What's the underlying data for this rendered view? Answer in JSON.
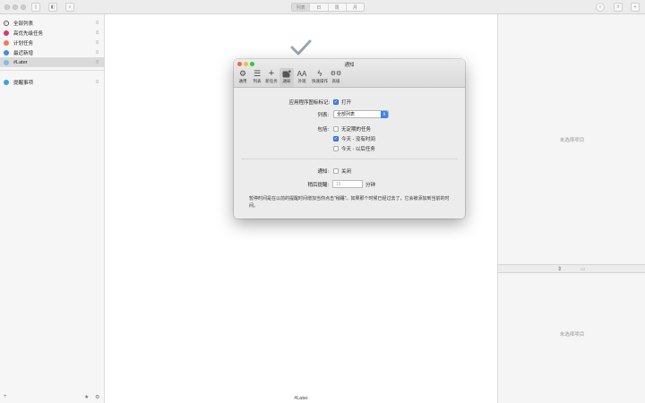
{
  "toolbar": {
    "view_segments": [
      "列表",
      "日",
      "周",
      "月"
    ],
    "active_segment": 0
  },
  "sidebar": {
    "items": [
      {
        "label": "全部列表",
        "count": "0",
        "color": "#ffffff",
        "icon": "check-circle-icon"
      },
      {
        "label": "高优先级任务",
        "count": "0",
        "color": "#e0336e"
      },
      {
        "label": "计划任务",
        "count": "0",
        "color": "#f07b5a"
      },
      {
        "label": "最近新增",
        "count": "0",
        "color": "#3f8fd8"
      },
      {
        "label": "#Later",
        "count": "0",
        "color": "#7bbde8",
        "selected": true
      },
      {
        "label": "提醒事项",
        "count": "0",
        "color": "#3aa3dc"
      }
    ]
  },
  "main": {
    "footer_title": "#Later"
  },
  "right": {
    "top_empty": "未选择项目",
    "bottom_empty": "未选择项目"
  },
  "prefs": {
    "title": "通知",
    "tabs": [
      {
        "label": "通用",
        "icon": "gear-icon"
      },
      {
        "label": "列表",
        "icon": "list-icon"
      },
      {
        "label": "新任务",
        "icon": "plus-icon"
      },
      {
        "label": "通知",
        "icon": "notification-icon",
        "active": true
      },
      {
        "label": "外观",
        "icon": "font-size-icon"
      },
      {
        "label": "快速操作",
        "icon": "lightning-icon"
      },
      {
        "label": "高级",
        "icon": "gears-icon"
      }
    ],
    "badge_label": "应用程序图标标记:",
    "badge_open": "打开",
    "list_label": "列表:",
    "list_value": "全部列表",
    "include_label": "包括:",
    "include_options": [
      {
        "label": "无定期的任务",
        "checked": false
      },
      {
        "label": "今天 - 没有时间",
        "checked": true
      },
      {
        "label": "今天 - 以后任务",
        "checked": false
      }
    ],
    "notify_label": "通知:",
    "notify_value": "关闭",
    "snooze_label": "稍后提醒:",
    "snooze_placeholder": "10",
    "snooze_unit": "分钟",
    "description": "暂停时间是在以前的提醒时间增加当你点击\"稍睡\"。如果那个时候已经过去了，它会被添加到当前的时间。"
  }
}
